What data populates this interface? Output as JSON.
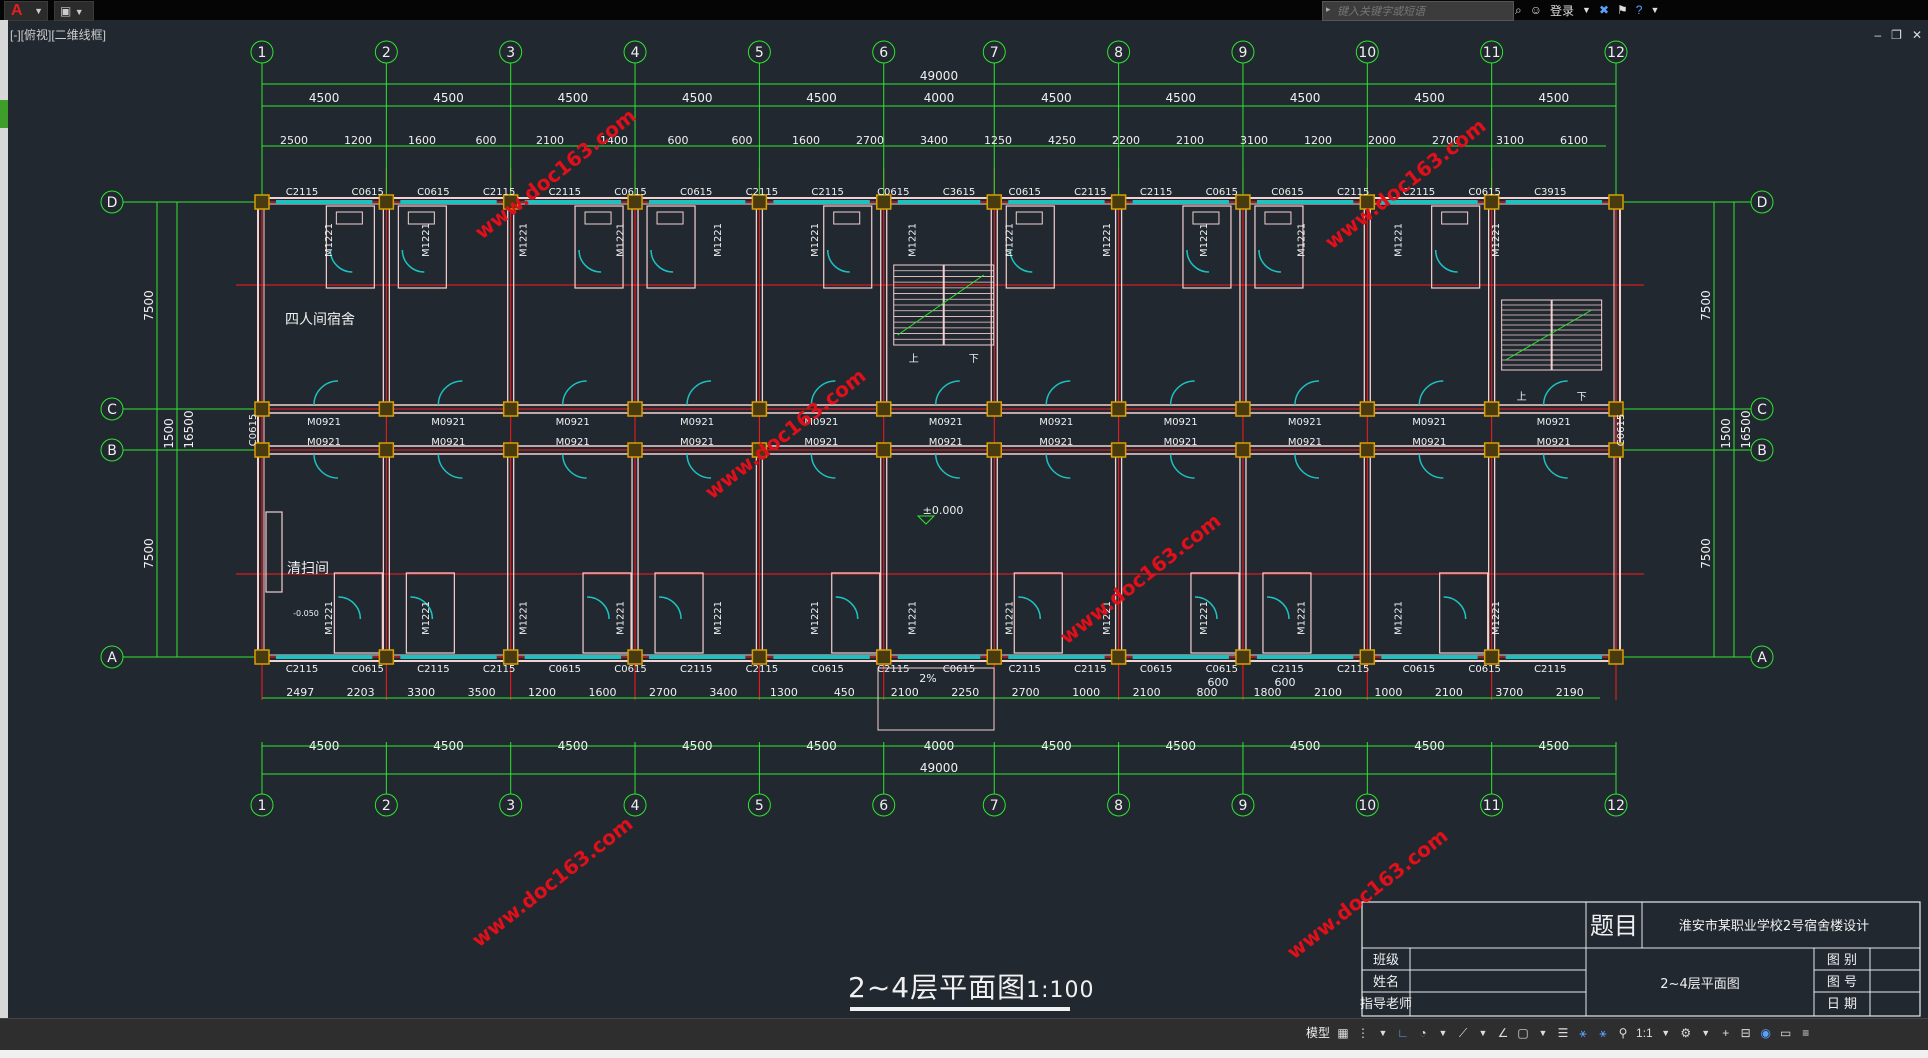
{
  "app": {
    "logo": "A",
    "search_placeholder": "键入关键字或短语",
    "login_label": "登录",
    "viewport_label": "[-][俯视][二维线框]"
  },
  "colors": {
    "background": "#212830",
    "grid_line": "#ff1a1a",
    "axis_green": "#2ee62e",
    "wall": "#f4d0d0",
    "window": "#1fc0c0",
    "column": "#d8a000",
    "text": "#f0f0f0",
    "watermark": "#e0101a"
  },
  "drawing": {
    "axes_columns": [
      "1",
      "2",
      "3",
      "4",
      "5",
      "6",
      "7",
      "8",
      "9",
      "10",
      "11",
      "12"
    ],
    "axes_rows": [
      "D",
      "C",
      "B",
      "A"
    ],
    "bay_dims": [
      "4500",
      "4500",
      "4500",
      "4500",
      "4500",
      "4000",
      "4500",
      "4500",
      "4500",
      "4500",
      "4500"
    ],
    "total_dim": "49000",
    "top_detail_dims": [
      "2500",
      "1200",
      "1600",
      "600",
      "2100",
      "1400",
      "600",
      "600",
      "1600",
      "2700",
      "3400",
      "1250",
      "4250",
      "2200",
      "2100",
      "3100",
      "1200",
      "2000",
      "2700",
      "3100",
      "6100"
    ],
    "bottom_detail_dims": [
      "2497",
      "2203",
      "3300",
      "3500",
      "1200",
      "1600",
      "2700",
      "3400",
      "1300",
      "450",
      "2100",
      "2250",
      "2700",
      "1000",
      "2100",
      "800",
      "1800",
      "2100",
      "1000",
      "2100",
      "3700",
      "2190"
    ],
    "bottom_small_dims": [
      "600",
      "600"
    ],
    "left_dims": [
      "7500",
      "1500",
      "7500",
      "16500"
    ],
    "right_dims": [
      "7500",
      "1500",
      "7500",
      "16500"
    ],
    "top_windows": [
      "C2115",
      "C0615",
      "C0615",
      "C2115",
      "C2115",
      "C0615",
      "C0615",
      "C2115",
      "C2115",
      "C0615",
      "C3615",
      "C0615",
      "C2115",
      "C2115",
      "C0615",
      "C0615",
      "C2115",
      "C2115",
      "C0615",
      "C3915"
    ],
    "bottom_windows": [
      "C2115",
      "C0615",
      "C2115",
      "C2115",
      "C0615",
      "C0615",
      "C2115",
      "C2115",
      "C0615",
      "C2115",
      "C0615",
      "C2115",
      "C2115",
      "C0615",
      "C0615",
      "C2115",
      "C2115",
      "C0615",
      "C0615",
      "C2115"
    ],
    "side_windows": [
      "C0615",
      "C0615"
    ],
    "door_labels_corridor": [
      "M0921",
      "M0921",
      "M0921",
      "M0921",
      "M0921",
      "M0921",
      "M0921",
      "M0921",
      "M0921",
      "M0921",
      "M0921"
    ],
    "door_labels_bath": [
      "M1221",
      "M1221",
      "M1221",
      "M1221",
      "M1221",
      "M1221",
      "M1221",
      "M1221",
      "M1221",
      "M1221",
      "M1221",
      "M1221",
      "M1221"
    ],
    "room_label_top": "四人间宿舍",
    "room_label_bottom": "清扫间",
    "level_label": "±0.000",
    "small_level": "-0.050",
    "slope_label": "2%",
    "stair_up": "上",
    "stair_down": "下",
    "drawing_title": "2~4层平面图",
    "drawing_scale": "1:100"
  },
  "title_block": {
    "heading": "题目",
    "project": "淮安市某职业学校2号宿舍楼设计",
    "drawing_name": "2~4层平面图",
    "left_labels": [
      "班级",
      "姓名",
      "指导老师"
    ],
    "right_labels": [
      "图 别",
      "图 号",
      "日 期"
    ]
  },
  "watermark": "www.doc163.com",
  "statusbar": {
    "model_label": "模型",
    "scale_label": "1:1"
  }
}
